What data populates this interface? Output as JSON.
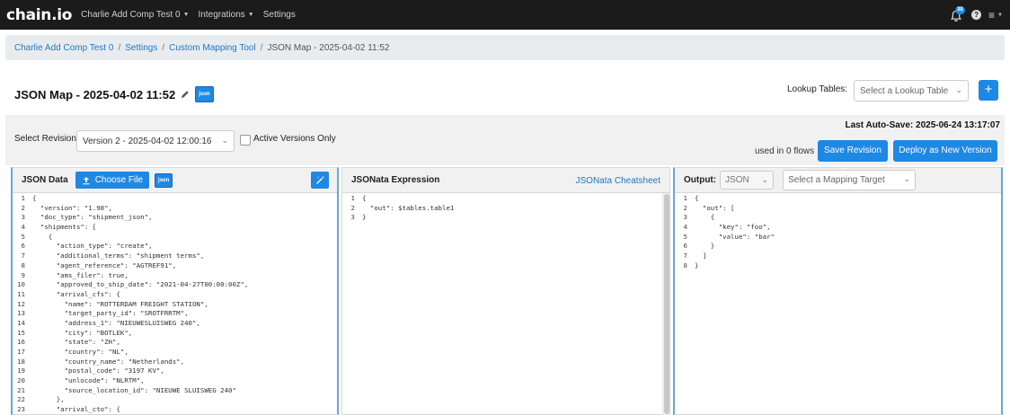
{
  "nav": {
    "logo": "chain.io",
    "items": [
      {
        "label": "Charlie Add Comp Test 0",
        "caret": true
      },
      {
        "label": "Integrations",
        "caret": true
      },
      {
        "label": "Settings",
        "caret": false
      }
    ],
    "notification_count": "38",
    "icons": [
      "bell-icon",
      "help-icon",
      "menu-icon"
    ]
  },
  "breadcrumb": {
    "items": [
      "Charlie Add Comp Test 0",
      "Settings",
      "Custom Mapping Tool"
    ],
    "current": "JSON Map - 2025-04-02 11:52"
  },
  "title": {
    "text": "JSON Map - 2025-04-02 11:52",
    "tag": "json"
  },
  "lookup": {
    "label": "Lookup Tables:",
    "placeholder": "Select a Lookup Table"
  },
  "autosave": "Last Auto-Save: 2025-06-24 13:17:07",
  "revision": {
    "label": "Select Revision",
    "value": "Version 2 - 2025-04-02 12:00:16",
    "active_only_label": "Active Versions Only"
  },
  "flows_text": "used in 0 flows",
  "buttons": {
    "save_revision": "Save Revision",
    "deploy": "Deploy as New Version"
  },
  "panels": {
    "data": {
      "title": "JSON Data",
      "choose_file": "Choose File",
      "tag": "json",
      "lines": [
        "{",
        "  \"version\": \"1.98\",",
        "  \"doc_type\": \"shipment_json\",",
        "  \"shipments\": [",
        "    {",
        "      \"action_type\": \"create\",",
        "      \"additional_terms\": \"shipment terms\",",
        "      \"agent_reference\": \"AGTREF91\",",
        "      \"ams_filer\": true,",
        "      \"approved_to_ship_date\": \"2021-04-27T00:00:00Z\",",
        "      \"arrival_cfs\": {",
        "        \"name\": \"ROTTERDAM FREIGHT STATION\",",
        "        \"target_party_id\": \"SROTFRRTM\",",
        "        \"address_1\": \"NIEUWESLUISWEG 240\",",
        "        \"city\": \"BOTLEK\",",
        "        \"state\": \"ZH\",",
        "        \"country\": \"NL\",",
        "        \"country_name\": \"Netherlands\",",
        "        \"postal_code\": \"3197 KV\",",
        "        \"unlocode\": \"NLRTM\",",
        "        \"source_location_id\": \"NIEUWE SLUISWEG 240\"",
        "      },",
        "      \"arrival_cto\": {"
      ]
    },
    "expression": {
      "title": "JSONata Expression",
      "cheatsheet": "JSONata Cheatsheet",
      "lines": [
        "{",
        "  \"out\": $tables.table1",
        "}"
      ]
    },
    "output": {
      "title": "Output:",
      "format": "JSON",
      "target_placeholder": "Select a Mapping Target",
      "lines": [
        "{",
        "  \"out\": [",
        "    {",
        "      \"key\": \"foo\",",
        "      \"value\": \"bar\"",
        "    }",
        "  ]",
        "}"
      ]
    }
  }
}
